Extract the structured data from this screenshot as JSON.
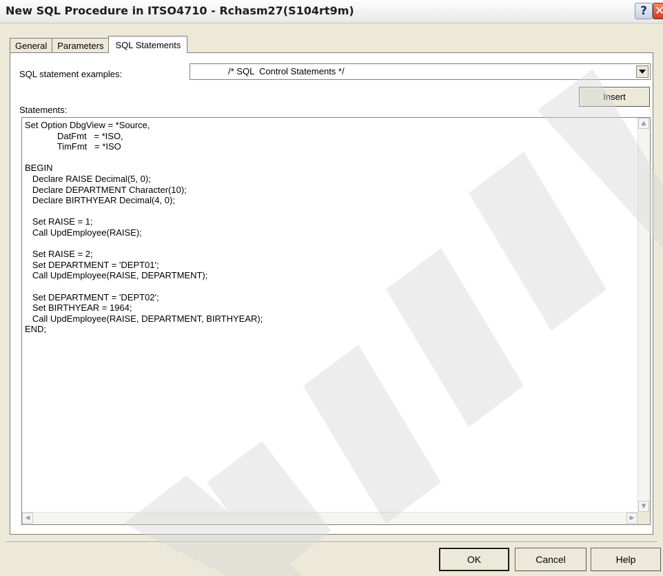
{
  "window": {
    "title": "New SQL Procedure in ITSO4710 - Rchasm27(S104rt9m)",
    "help_glyph": "?",
    "close_glyph": "✕"
  },
  "tabs": [
    {
      "label": "General",
      "active": false
    },
    {
      "label": "Parameters",
      "active": false
    },
    {
      "label": "SQL Statements",
      "active": true
    }
  ],
  "sql_examples": {
    "label": "SQL statement examples:",
    "selected": "/* SQL  Control Statements */",
    "insert_label": "Insert"
  },
  "statements": {
    "label": "Statements:",
    "text": "Set Option DbgView = *Source,\n             DatFmt   = *ISO,\n             TimFmt   = *ISO\n\nBEGIN\n   Declare RAISE Decimal(5, 0);\n   Declare DEPARTMENT Character(10);\n   Declare BIRTHYEAR Decimal(4, 0);\n\n   Set RAISE = 1;\n   Call UpdEmployee(RAISE);\n\n   Set RAISE = 2;\n   Set DEPARTMENT = 'DEPT01';\n   Call UpdEmployee(RAISE, DEPARTMENT);\n\n   Set DEPARTMENT = 'DEPT02';\n   Set BIRTHYEAR = 1964;\n   Call UpdEmployee(RAISE, DEPARTMENT, BIRTHYEAR);\nEND;"
  },
  "buttons": {
    "ok": "OK",
    "cancel": "Cancel",
    "help": "Help"
  },
  "colors": {
    "dialog_bg": "#ece9d8",
    "close_button": "#d4502c",
    "watermark": "#e6e6e6"
  },
  "icons": [
    "help-icon",
    "close-icon",
    "dropdown-arrow-icon",
    "scroll-up-icon",
    "scroll-down-icon",
    "scroll-left-icon",
    "scroll-right-icon"
  ]
}
